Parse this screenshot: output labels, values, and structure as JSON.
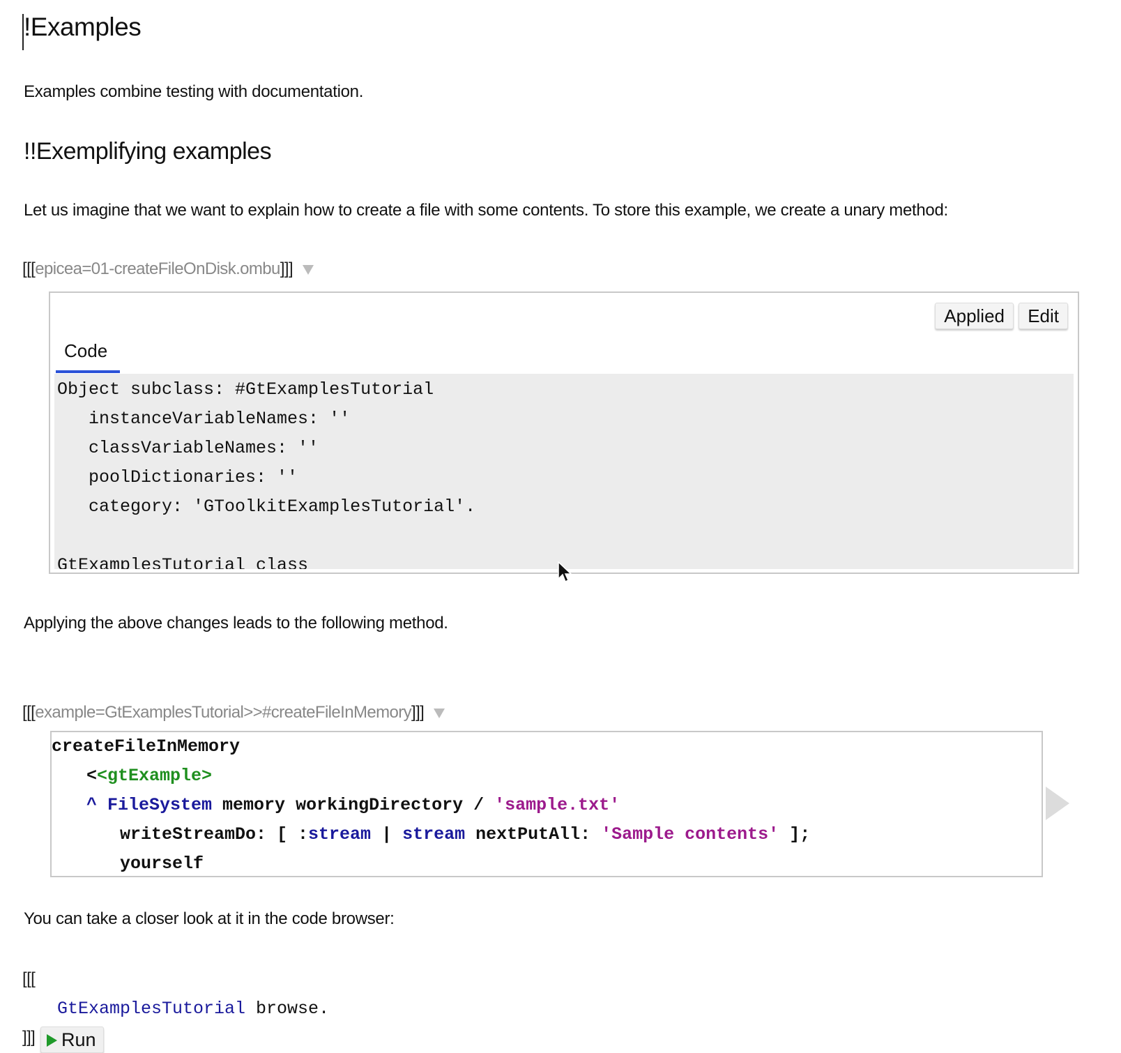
{
  "heading": "!Examples",
  "intro": "Examples combine testing with documentation.",
  "subheading": "!!Exemplifying examples",
  "para_unary": "Let us imagine that we want to explain how to create a file with some contents. To store this example, we create a unary method:",
  "epicea_ref": {
    "open": "[[[",
    "text": "epicea=01-createFileOnDisk.ombu",
    "close": "]]]"
  },
  "epicea_panel": {
    "applied_label": "Applied",
    "edit_label": "Edit",
    "tab_label": "Code",
    "code_lines": [
      "Object subclass: #GtExamplesTutorial",
      "   instanceVariableNames: ''",
      "   classVariableNames: ''",
      "   poolDictionaries: ''",
      "   category: 'GToolkitExamplesTutorial'.",
      "",
      "GtExamplesTutorial class"
    ]
  },
  "para_applying": "Applying the above changes leads to the following method.",
  "example_ref": {
    "open": "[[[",
    "text": "example=GtExamplesTutorial>>#createFileInMemory",
    "close": "]]]"
  },
  "method": {
    "selector": "createFileInMemory",
    "pragma": "<gtExample>",
    "line3": {
      "caret": "^ ",
      "receiver": "FileSystem",
      "rest": " memory workingDirectory / ",
      "string": "'sample.txt'"
    },
    "line4": {
      "prefix": "writeStreamDo: [ :",
      "param": "stream",
      "bar": " | ",
      "var": "stream",
      "mid": " nextPutAll: ",
      "string": "'Sample contents'",
      "suffix": " ];"
    },
    "line5": "yourself"
  },
  "para_browser": "You can take a closer look at it in the code browser:",
  "browse_snippet": {
    "open": "[[[",
    "class_name": "GtExamplesTutorial",
    "message": " browse.",
    "close": "]]]",
    "run_label": "Run"
  },
  "colors": {
    "keyword_blue": "#1a1a9c",
    "string_purple": "#9c1a8c",
    "pragma_green": "#1f8f1f",
    "tab_underline": "#2b52d8",
    "run_green": "#1f9a2a"
  }
}
